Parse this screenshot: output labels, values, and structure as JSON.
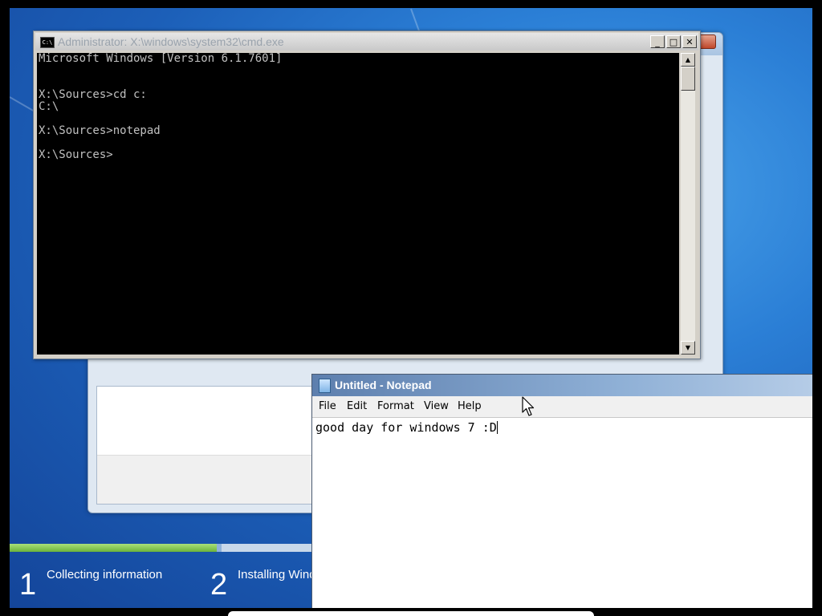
{
  "cmd": {
    "title": "Administrator: X:\\windows\\system32\\cmd.exe",
    "icon_text": "C:\\",
    "minimize": "_",
    "maximize": "□",
    "close": "✕",
    "lines": [
      "Microsoft Windows [Version 6.1.7601]",
      "",
      "",
      "X:\\Sources>cd c:",
      "C:\\",
      "",
      "X:\\Sources>notepad",
      "",
      "X:\\Sources>"
    ]
  },
  "notepad": {
    "title": "Untitled - Notepad",
    "menu": [
      "File",
      "Edit",
      "Format",
      "View",
      "Help"
    ],
    "content": "good day for windows 7 :D"
  },
  "setup": {
    "steps": [
      {
        "number": "1",
        "label": "Collecting information"
      },
      {
        "number": "2",
        "label": "Installing Windows"
      }
    ],
    "progress": 0.26
  },
  "icons": {
    "cmd": "cmd-app-icon",
    "notepad": "notepad-app-icon",
    "cursor": "mouse-pointer-icon"
  }
}
